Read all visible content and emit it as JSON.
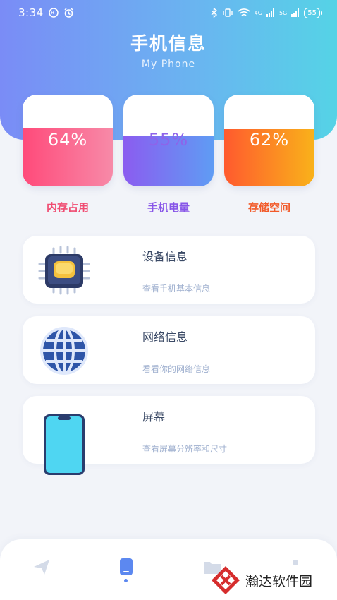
{
  "status_bar": {
    "time": "3:34",
    "network_tag": "4G",
    "network_tag2": "5G",
    "battery": "55"
  },
  "header": {
    "title": "手机信息",
    "subtitle": "My Phone"
  },
  "gauges": [
    {
      "label": "内存占用",
      "percent_text": "64%",
      "fill_fraction": 0.64,
      "color": "#f04c72"
    },
    {
      "label": "手机电量",
      "percent_text": "55%",
      "fill_fraction": 0.55,
      "color": "#8856e8"
    },
    {
      "label": "存储空间",
      "percent_text": "62%",
      "fill_fraction": 0.62,
      "color": "#f25a2a"
    }
  ],
  "cards": [
    {
      "title": "设备信息",
      "desc": "查看手机基本信息",
      "icon": "chip-icon"
    },
    {
      "title": "网络信息",
      "desc": "看看你的网络信息",
      "icon": "globe-icon"
    },
    {
      "title": "屏幕",
      "desc": "查看屏幕分辨率和尺寸",
      "icon": "phone-screen-icon"
    }
  ],
  "bottom_nav": {
    "items": [
      "send-icon",
      "phone-icon",
      "folder-icon",
      "more-icon"
    ],
    "active_index": 1
  },
  "watermark": {
    "text": "瀚达软件园"
  }
}
